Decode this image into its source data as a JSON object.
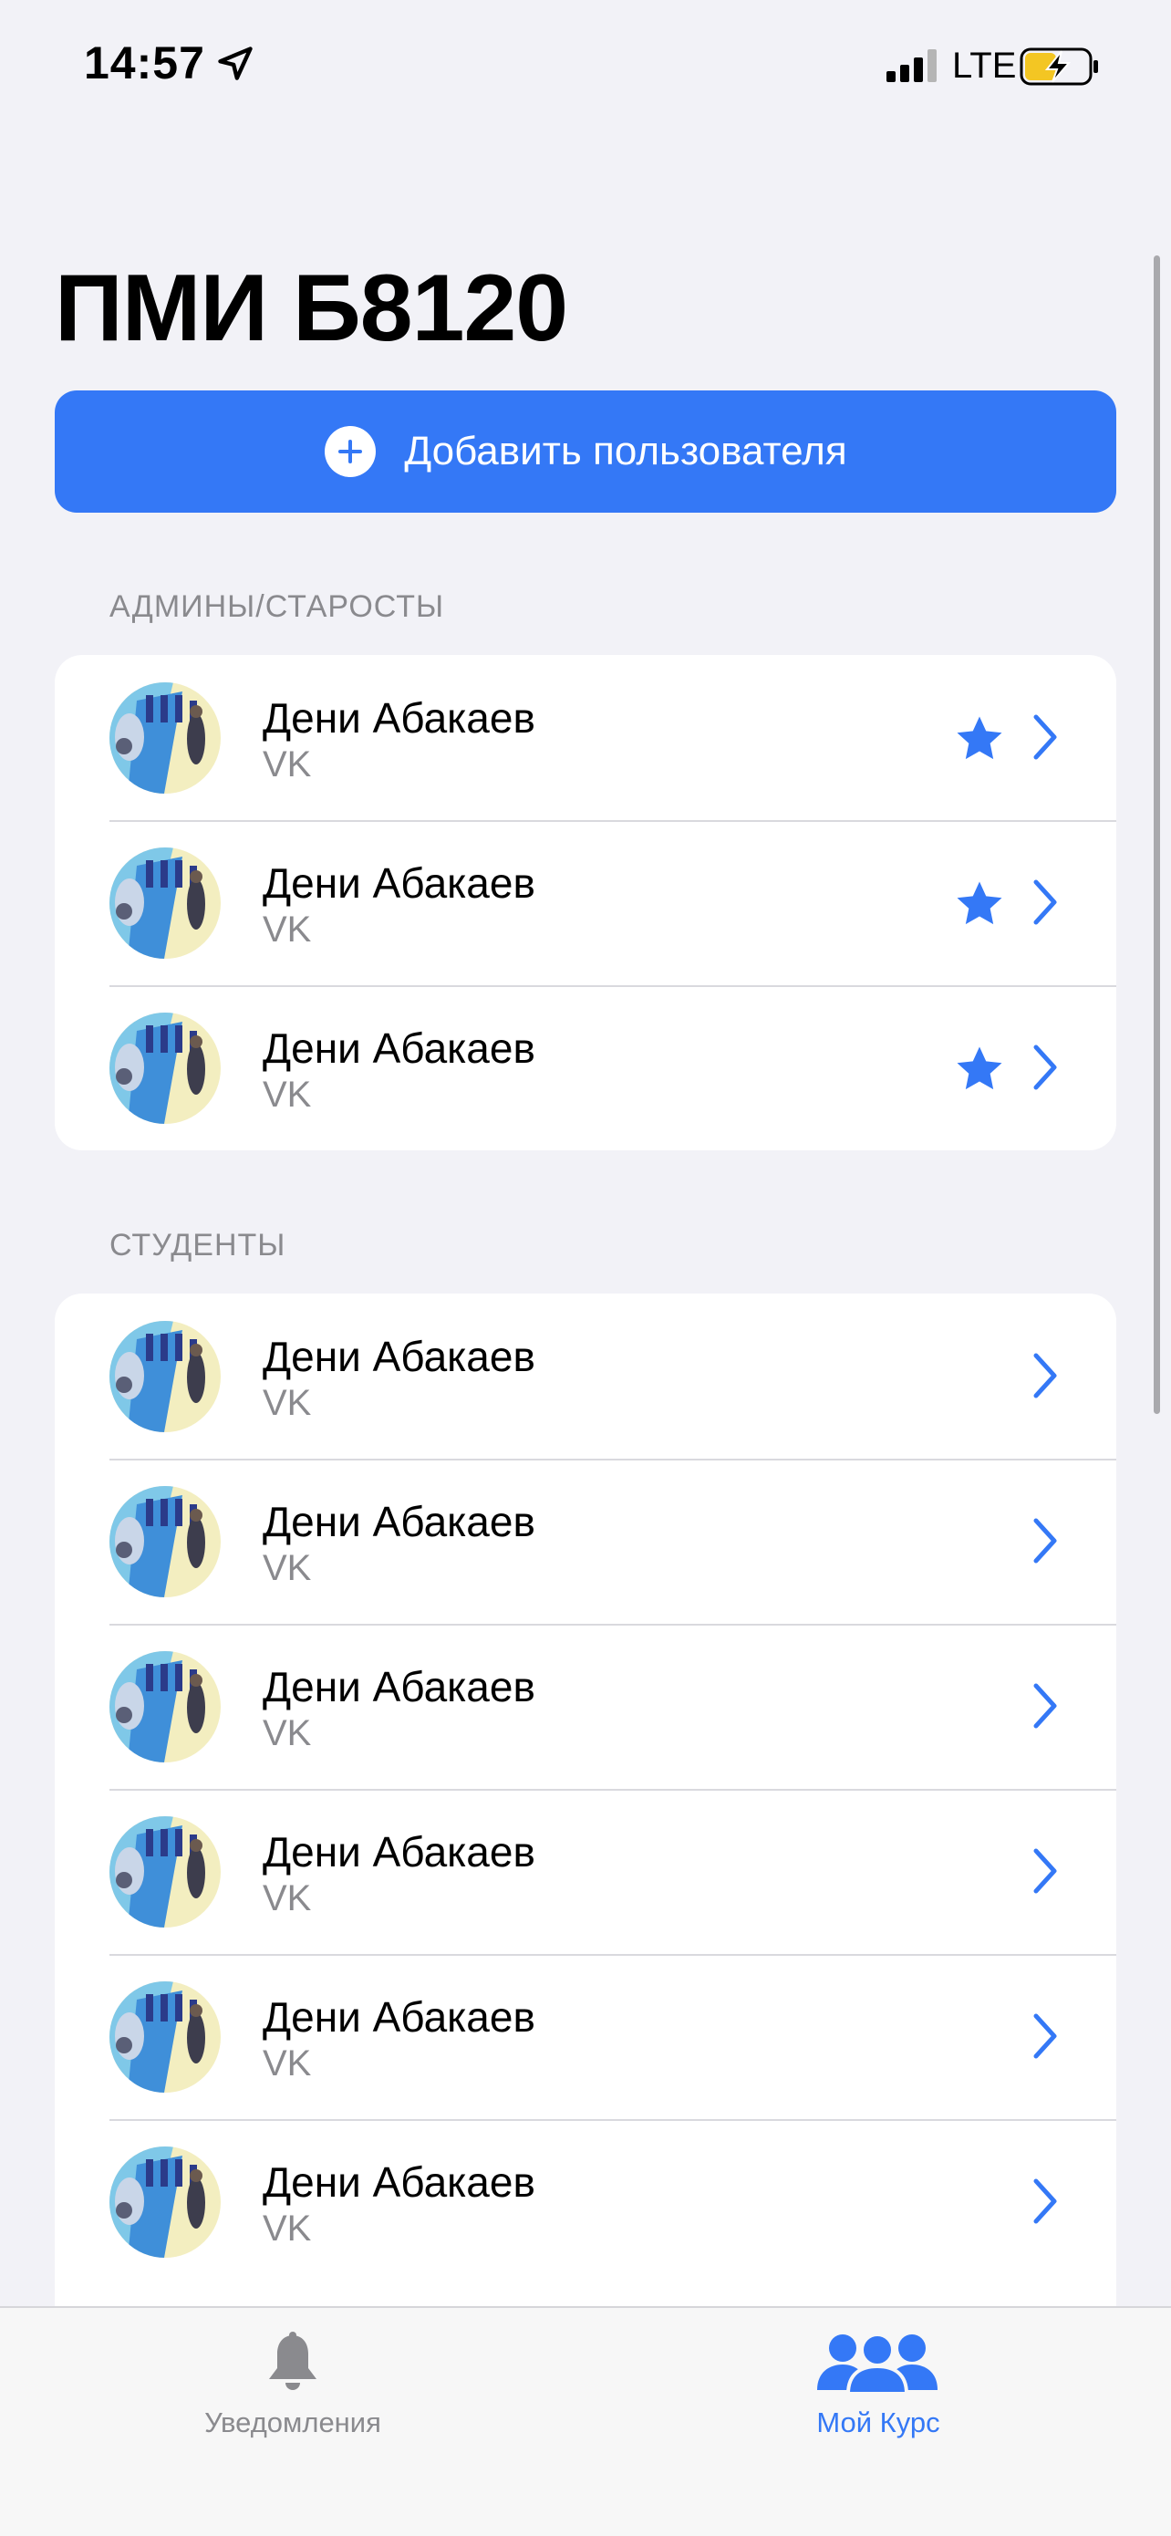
{
  "status_bar": {
    "time": "14:57",
    "network": "LTE"
  },
  "page": {
    "title": "ПМИ Б8120"
  },
  "add_button": {
    "label": "Добавить пользователя"
  },
  "sections": {
    "admins": {
      "header": "АДМИНЫ/СТАРОСТЫ",
      "items": [
        {
          "name": "Дени Абакаев",
          "source": "VK"
        },
        {
          "name": "Дени Абакаев",
          "source": "VK"
        },
        {
          "name": "Дени Абакаев",
          "source": "VK"
        }
      ]
    },
    "students": {
      "header": "СТУДЕНТЫ",
      "items": [
        {
          "name": "Дени Абакаев",
          "source": "VK"
        },
        {
          "name": "Дени Абакаев",
          "source": "VK"
        },
        {
          "name": "Дени Абакаев",
          "source": "VK"
        },
        {
          "name": "Дени Абакаев",
          "source": "VK"
        },
        {
          "name": "Дени Абакаев",
          "source": "VK"
        },
        {
          "name": "Дени Абакаев",
          "source": "VK"
        }
      ]
    }
  },
  "tab_bar": {
    "tabs": [
      {
        "label": "Уведомления",
        "icon": "bell-icon",
        "active": false
      },
      {
        "label": "Мой Курс",
        "icon": "people-icon",
        "active": true
      }
    ]
  },
  "colors": {
    "accent": "#3478f6",
    "inactive": "#8a8a8e",
    "background": "#f2f2f7"
  }
}
